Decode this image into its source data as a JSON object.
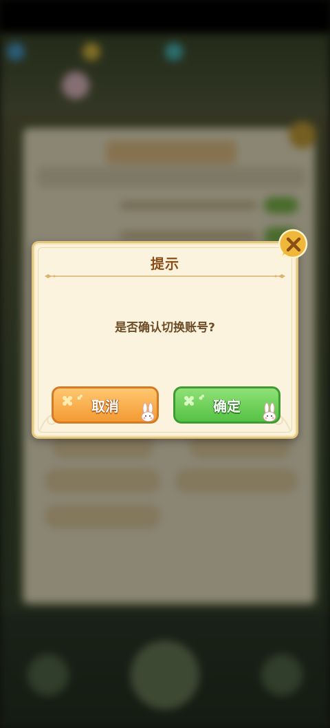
{
  "dialog": {
    "title": "提示",
    "message": "是否确认切换账号?",
    "cancel_label": "取消",
    "confirm_label": "确定"
  },
  "icons": {
    "close": "close-icon",
    "bunny": "bunny-icon",
    "flower": "flower-icon"
  },
  "colors": {
    "title_text": "#8a4d16",
    "message_text": "#6b4a26",
    "cancel_button": "#f39a33",
    "confirm_button": "#55c244",
    "close_button": "#f0b83a"
  }
}
